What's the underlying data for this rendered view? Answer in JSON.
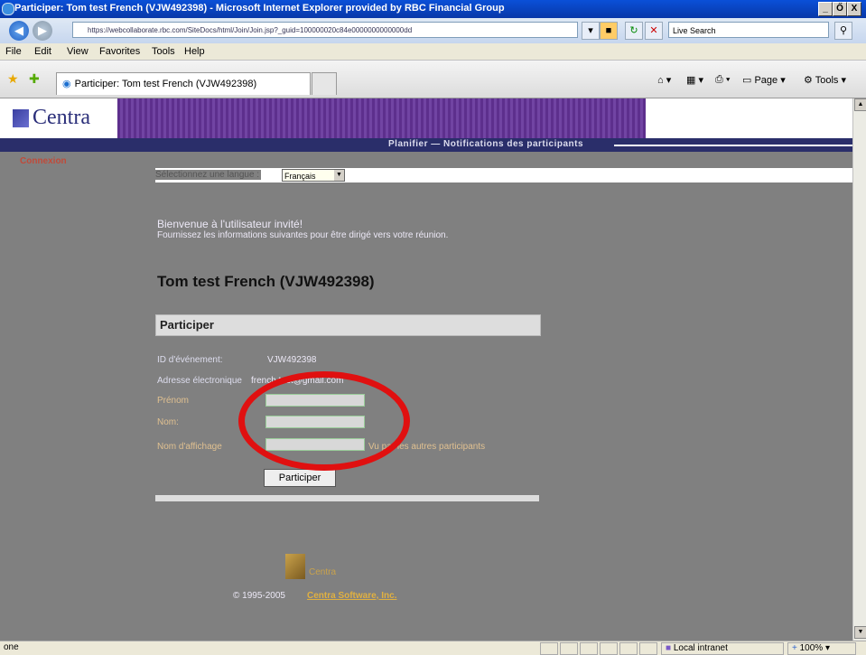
{
  "window": {
    "title": "Participer: Tom test French (VJW492398) - Microsoft Internet Explorer provided by RBC Financial Group",
    "controls": [
      "_",
      "Ő",
      "X"
    ]
  },
  "address_bar": {
    "url": "https://webcollaborate.rbc.com/SiteDocs/html/Join/Join.jsp?_guid=100000020c84e0000000000000dd",
    "search_placeholder": "Live Search"
  },
  "menu": [
    "File",
    "Edit",
    "View",
    "Favorites",
    "Tools",
    "Help"
  ],
  "tab": {
    "label": "Participer: Tom test French (VJW492398)"
  },
  "commands": {
    "page": "Page",
    "tools": "Tools"
  },
  "brand": {
    "logo_text": "Centra",
    "banner_text": "Planifier — Notifications des participants"
  },
  "sidebar": {
    "connect_link": "Connexion"
  },
  "language": {
    "label": "Sélectionnez une langue :",
    "selected": "Français"
  },
  "welcome": {
    "line1": "Bienvenue à l'utilisateur invité!",
    "line2": "Fournissez les informations suivantes pour être dirigé vers votre réunion."
  },
  "meeting_title": "Tom test French (VJW492398)",
  "join": {
    "header": "Participer",
    "event_id_label": "ID d'événement:",
    "event_id_value": "VJW492398",
    "email_label": "Adresse électronique",
    "email_value": "french.test@gmail.com",
    "first_name_label": "Prénom",
    "last_name_label": "Nom:",
    "display_name_label": "Nom d'affichage",
    "display_name_hint": "Vu par les autres participants",
    "button_label": "Participer"
  },
  "footer": {
    "logo_text": "Centra",
    "copyright": "© 1995-2005",
    "company_link": "Centra Software, Inc."
  },
  "statusbar": {
    "left": "one",
    "zone": "Local intranet",
    "zoom": "100%"
  }
}
